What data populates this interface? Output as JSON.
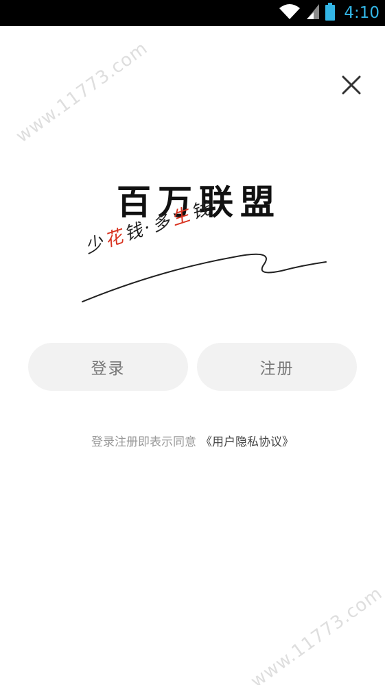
{
  "status_bar": {
    "time": "4:10",
    "icons": [
      "wifi-icon",
      "signal-icon",
      "battery-icon"
    ],
    "time_color": "#33b5e5"
  },
  "watermark": {
    "text": "www.11773.com"
  },
  "close": {
    "icon": "close-icon"
  },
  "logo": {
    "title": "百万联盟",
    "slogan_parts": [
      "少",
      "花",
      "钱",
      "·",
      "多",
      "生",
      "钱"
    ],
    "accent_color": "#d8321f"
  },
  "buttons": {
    "login_label": "登录",
    "register_label": "注册"
  },
  "agreement": {
    "text": "登录注册即表示同意",
    "link": "《用户隐私协议》"
  }
}
